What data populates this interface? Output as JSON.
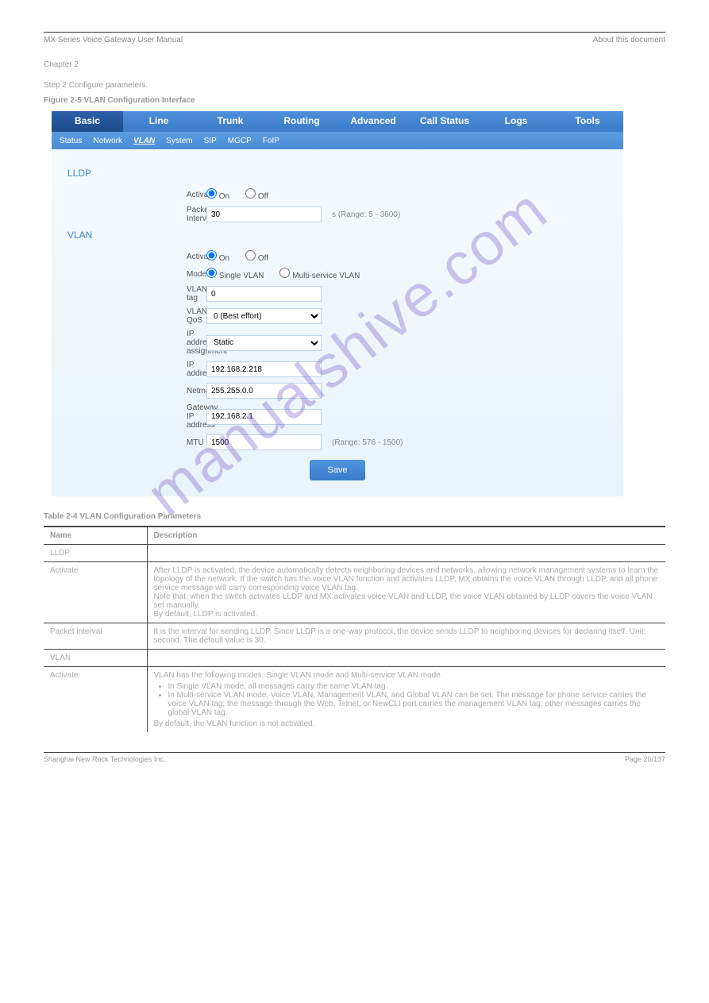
{
  "header": {
    "left": "MX Series Voice Gateway User Manual",
    "right": "About this document",
    "chapter": "Chapter 2",
    "step": "Step 2    Configure parameters.",
    "figure": "Figure 2-5 VLAN Configuration Interface"
  },
  "tabs": {
    "main": [
      "Basic",
      "Line",
      "Trunk",
      "Routing",
      "Advanced",
      "Call Status",
      "Logs",
      "Tools"
    ],
    "sub": [
      "Status",
      "Network",
      "VLAN",
      "System",
      "SIP",
      "MGCP",
      "FoIP"
    ]
  },
  "sections": {
    "lldp": "LLDP",
    "vlan": "VLAN"
  },
  "form": {
    "lldp_activate_label": "Activate",
    "lldp_on": "On",
    "lldp_off": "Off",
    "packet_interval_label": "Packet Interval",
    "packet_interval_value": "30",
    "packet_interval_hint": "s (Range: 5 - 3600)",
    "vlan_activate_label": "Activate",
    "vlan_on": "On",
    "vlan_off": "Off",
    "mode_label": "Mode",
    "mode_single": "Single VLAN",
    "mode_multi": "Multi-service VLAN",
    "vlan_tag_label": "VLAN tag",
    "vlan_tag_value": "0",
    "vlan_qos_label": "VLAN QoS",
    "vlan_qos_value": "0 (Best effort)",
    "ip_assign_label": "IP address assignment",
    "ip_assign_value": "Static",
    "ip_addr_label": "IP address",
    "ip_addr_value": "192.168.2.218",
    "netmask_label": "Netmask",
    "netmask_value": "255.255.0.0",
    "gateway_label": "Gateway IP address",
    "gateway_value": "192.168.2.1",
    "mtu_label": "MTU",
    "mtu_value": "1500",
    "mtu_hint": "(Range: 576 - 1500)",
    "save": "Save"
  },
  "table": {
    "title": "Table 2-4    VLAN Configuration Parameters",
    "h1": "Name",
    "h2": "Description",
    "rows": [
      {
        "name": "LLDP",
        "desc": ""
      },
      {
        "name": "Activate",
        "desc": "After LLDP is activated, the device automatically detects neighboring devices and networks, allowing network management systems to learn the topology of the network. If the switch has the voice VLAN function and activates LLDP, MX obtains the voice VLAN through LLDP, and all phone service message will carry corresponding voice VLAN tag.\nNote that, when the switch activates LLDP and MX activates voice VLAN and LLDP, the voice VLAN obtained by LLDP covers the voice VLAN set manually.\nBy default, LLDP is activated."
      },
      {
        "name": "Packet interval",
        "desc": "It is the interval for sending LLDP. Since LLDP is a one-way protocol, the device sends LLDP to neighboring devices for declaring itself. Unit: second. The default value is 30."
      },
      {
        "name": "VLAN",
        "desc": ""
      },
      {
        "name": "Activate",
        "desc": "VLAN has the following modes: Single VLAN mode and Multi-service VLAN mode.",
        "bullets": [
          "In Single VLAN mode, all messages carry the same VLAN tag.",
          "In Multi-service VLAN mode, Voice VLAN, Management VLAN, and Global VLAN can be set. The message for phone service carries the voice VLAN tag; the message through the Web, Telnet, or NewCLI port carries the management VLAN tag; other messages carries the global VLAN tag."
        ],
        "extra": "By default, the VLAN function is not activated."
      }
    ]
  },
  "footer": {
    "left": "Shanghai New Rock Technologies Inc.",
    "right": "Page 20/137"
  },
  "watermark": "manualshive.com"
}
